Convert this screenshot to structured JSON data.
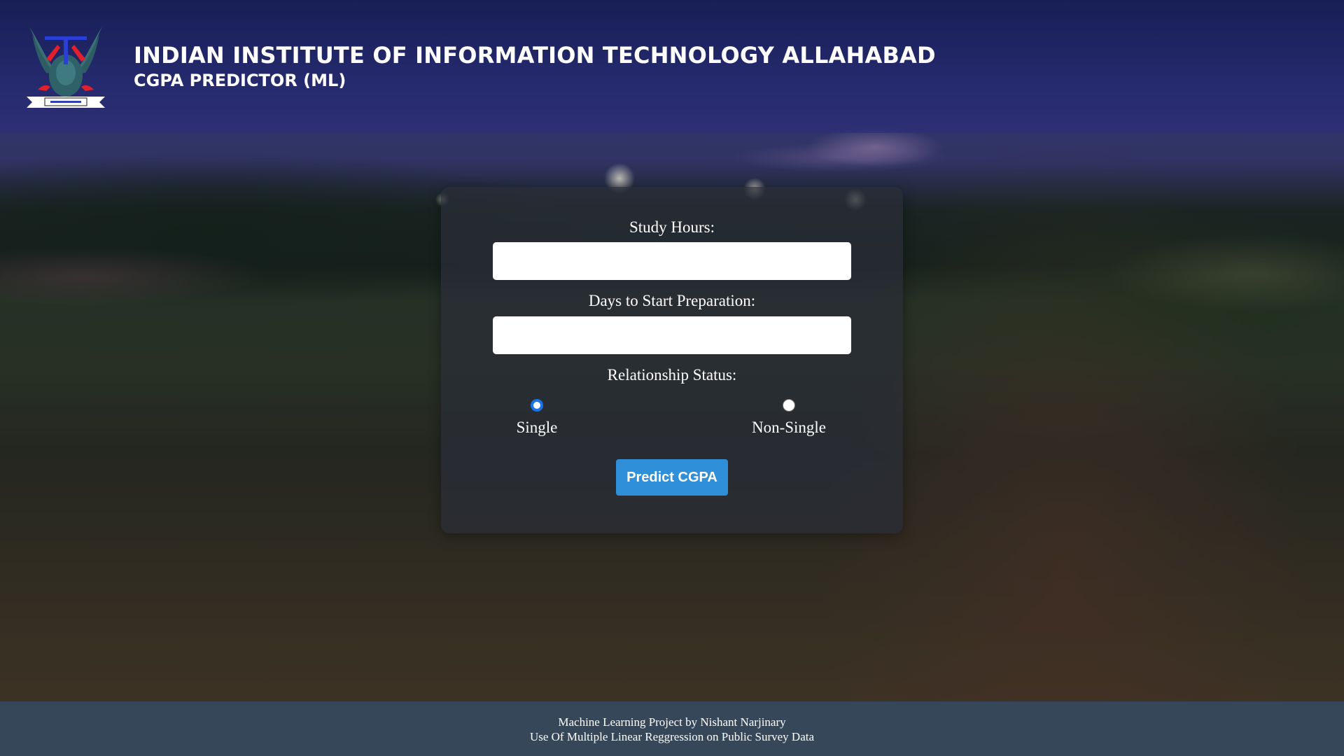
{
  "header": {
    "title": "INDIAN INSTITUTE OF INFORMATION TECHNOLOGY ALLAHABAD",
    "subtitle": "CGPA PREDICTOR (ML)",
    "logo_icon": "iiit-allahabad-emblem"
  },
  "form": {
    "study_hours": {
      "label": "Study Hours:",
      "value": ""
    },
    "days_to_start": {
      "label": "Days to Start Preparation:",
      "value": ""
    },
    "relationship_status": {
      "label": "Relationship Status:",
      "options": [
        {
          "label": "Single",
          "checked": true
        },
        {
          "label": "Non-Single",
          "checked": false
        }
      ]
    },
    "predict_button_label": "Predict CGPA"
  },
  "footer": {
    "line1": "Machine Learning Project by Nishant Narjinary",
    "line2": "Use Of Multiple Linear Reggression on Public Survey Data"
  },
  "colors": {
    "header_bg": "#1e2a6e",
    "button_bg": "#2f8fd8",
    "footer_bg": "#36475a",
    "radio_checked": "#1a73e8"
  }
}
